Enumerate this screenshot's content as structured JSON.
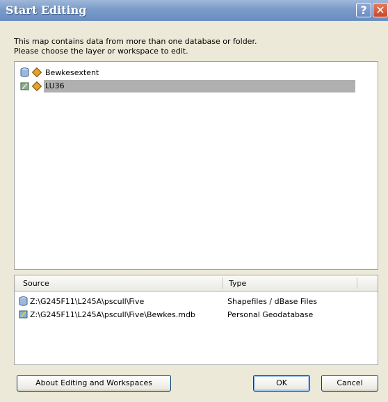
{
  "window": {
    "title": "Start Editing",
    "help_label": "?",
    "close_label": "✕"
  },
  "instructions": [
    "This map contains data from more than one database or folder.",
    "Please choose the layer or workspace to edit."
  ],
  "tree": {
    "items": [
      {
        "label": "Bewkesextent",
        "icon": "shapefile-workspace-icon",
        "selected": false
      },
      {
        "label": "LU36",
        "icon": "personal-geodatabase-icon",
        "selected": true
      }
    ]
  },
  "sources": {
    "columns": [
      "Source",
      "Type"
    ],
    "rows": [
      {
        "source": "Z:\\G245F11\\L245A\\pscull\\Five",
        "type": "Shapefiles / dBase Files",
        "icon": "shapefile-workspace-icon"
      },
      {
        "source": "Z:\\G245F11\\L245A\\pscull\\Five\\Bewkes.mdb",
        "type": "Personal Geodatabase",
        "icon": "personal-geodatabase-icon"
      }
    ]
  },
  "buttons": {
    "about": "About Editing and Workspaces",
    "ok": "OK",
    "cancel": "Cancel"
  },
  "colors": {
    "titlebar": "#7a9bc9",
    "selection": "#b0b0b0",
    "dialog_bg": "#ece9d8"
  }
}
